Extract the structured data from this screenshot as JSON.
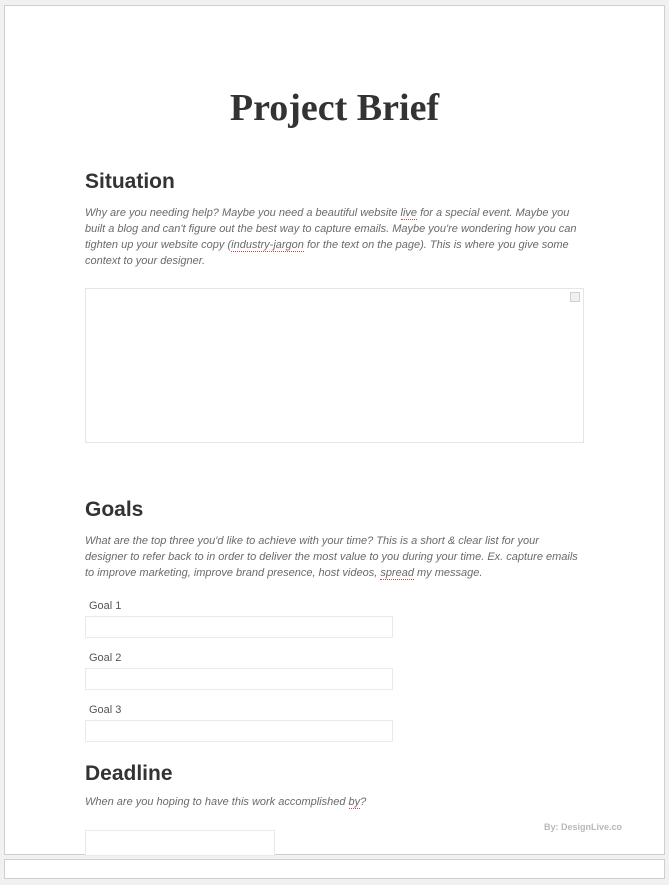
{
  "title": "Project Brief",
  "situation": {
    "heading": "Situation",
    "desc_pre": "Why are you needing help? Maybe you need a beautiful website ",
    "desc_u1": "live",
    "desc_mid1": " for a special event. Maybe you built a blog and can't figure out the best way to capture emails. Maybe you're wondering how you can tighten up your website copy (",
    "desc_u2": "industry-jargon",
    "desc_mid2": " for the text on the page). This is where you give some context to your designer.",
    "textarea_value": ""
  },
  "goals": {
    "heading": "Goals",
    "desc_pre": "What are the top three you'd like to achieve with your time? This is a short & clear list for your designer to refer back to in order to deliver the most value to you during your time. Ex. capture emails to improve marketing, improve brand presence, host videos, ",
    "desc_u1": "spread",
    "desc_post": " my message.",
    "items": [
      {
        "label": "Goal 1",
        "value": ""
      },
      {
        "label": "Goal 2",
        "value": ""
      },
      {
        "label": "Goal 3",
        "value": ""
      }
    ]
  },
  "deadline": {
    "heading": "Deadline",
    "desc_pre": "When are you hoping to have this work accomplished ",
    "desc_u1": "by",
    "desc_post": "?",
    "value": ""
  },
  "footer": {
    "credit": "By: DesignLive.co"
  }
}
